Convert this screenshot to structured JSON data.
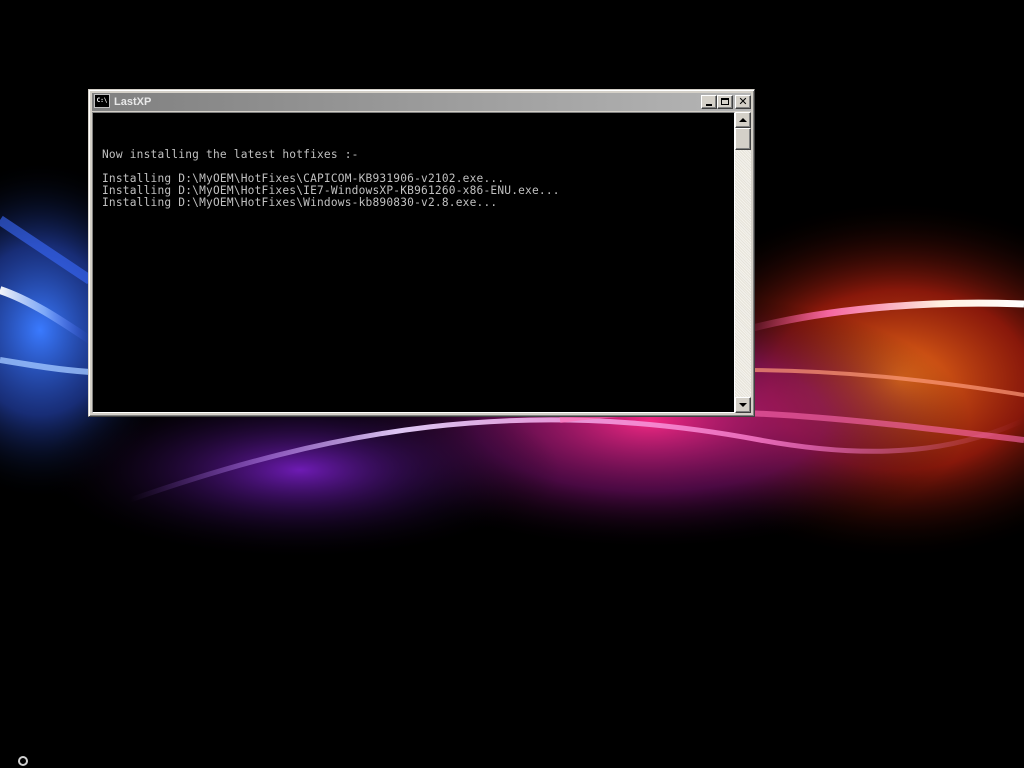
{
  "window": {
    "title": "LastXP",
    "icon": "console-icon",
    "icon_glyph": "C:\\",
    "buttons": {
      "minimize": "minimize-icon",
      "maximize": "maximize-icon",
      "close_glyph": "✕"
    }
  },
  "console": {
    "lines": [
      "",
      "",
      "Now installing the latest hotfixes :-",
      "",
      "Installing D:\\MyOEM\\HotFixes\\CAPICOM-KB931906-v2102.exe...",
      "Installing D:\\MyOEM\\HotFixes\\IE7-WindowsXP-KB961260-x86-ENU.exe...",
      "Installing D:\\MyOEM\\HotFixes\\Windows-kb890830-v2.8.exe..."
    ],
    "text_color": "#c0c0c0",
    "background": "#000000"
  },
  "theme": {
    "titlebar_start": "#808080",
    "titlebar_end": "#b5b5b5",
    "window_face": "#d4d0c8"
  }
}
